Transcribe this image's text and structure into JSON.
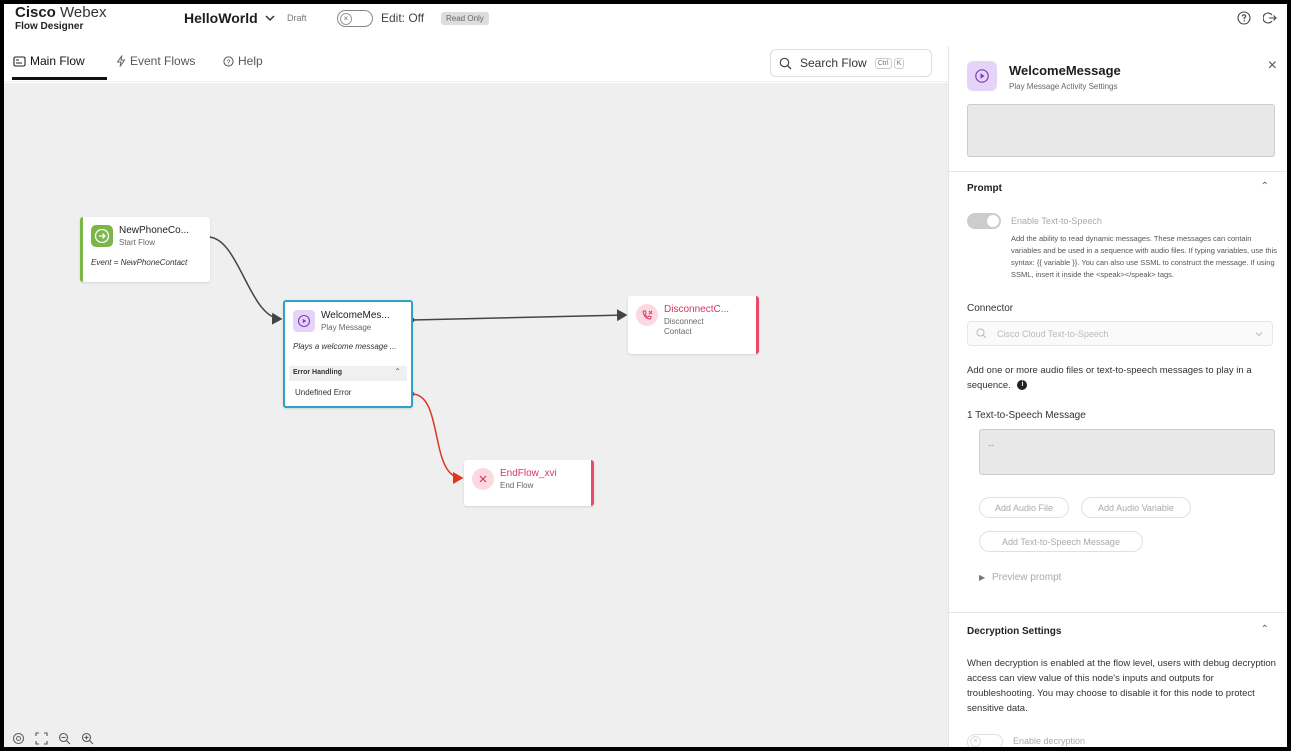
{
  "brand": {
    "name_bold": "Cisco",
    "name_light": "Webex",
    "product": "Flow Designer"
  },
  "header": {
    "flow_name": "HelloWorld",
    "status": "Draft",
    "toggle_knob": "×",
    "edit_state": "Edit: Off",
    "mode_badge": "Read Only"
  },
  "tabs": [
    {
      "label": "Main Flow",
      "icon": "flow-icon",
      "active": true
    },
    {
      "label": "Event Flows",
      "icon": "lightning-icon",
      "active": false
    },
    {
      "label": "Help",
      "icon": "help-icon",
      "active": false
    }
  ],
  "search": {
    "placeholder": "Search Flow",
    "kbd1": "Ctrl",
    "kbd2": "K"
  },
  "nodes": {
    "start": {
      "title": "NewPhoneCo...",
      "subtitle": "Start Flow",
      "description": "Event = NewPhoneContact",
      "color": "#7ab648"
    },
    "welcome": {
      "title": "WelcomeMes...",
      "subtitle": "Play Message",
      "description": "Plays a welcome message ...",
      "error_header": "Error Handling",
      "error_item": "Undefined Error",
      "color": "#2aa3c8"
    },
    "disconnect": {
      "title": "DisconnectC...",
      "subtitle_line1": "Disconnect",
      "subtitle_line2": "Contact",
      "color": "#e84a6a"
    },
    "end": {
      "title": "EndFlow_xvi",
      "subtitle": "End Flow",
      "color": "#e84a6a"
    }
  },
  "panel": {
    "title": "WelcomeMessage",
    "subtitle": "Play Message Activity Settings",
    "prompt_section": "Prompt",
    "tts_toggle_label": "Enable Text-to-Speech",
    "tts_help": "Add the ability to read dynamic messages. These messages can contain variables and be used in a sequence with audio files. If typing variables, use this syntax: {{ variable }}. You can also use SSML to construct the message. If using SSML, insert it inside the <speak></speak> tags.",
    "connector_label": "Connector",
    "connector_value": "Cisco Cloud Text-to-Speech",
    "add_audio_text": "Add one or more audio files or text-to-speech messages to play in a sequence.",
    "tts_message_label": "1  Text-to-Speech Message",
    "tts_message_placeholder": "--",
    "buttons": {
      "add_audio_file": "Add Audio File",
      "add_audio_variable": "Add Audio Variable",
      "add_tts_message": "Add Text-to-Speech Message"
    },
    "preview_prompt": "Preview prompt",
    "decryption_section": "Decryption Settings",
    "decryption_text": "When decryption is enabled at the flow level, users with debug decryption access can view value of this node's inputs and outputs for troubleshooting. You may choose to disable it for this node to protect sensitive data.",
    "enable_decryption": "Enable decryption"
  }
}
